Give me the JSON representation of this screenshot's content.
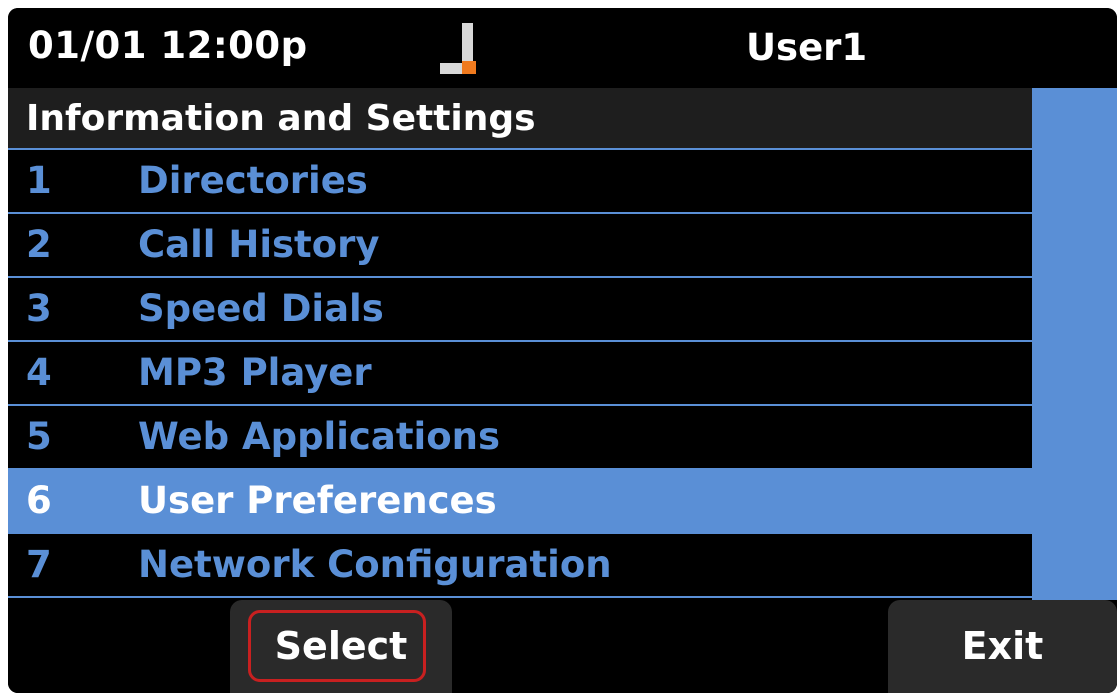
{
  "status": {
    "datetime": "01/01 12:00p",
    "user": "User1",
    "line_icon": "line-status-icon"
  },
  "menu": {
    "title": "Information and Settings",
    "items": [
      {
        "number": "1",
        "label": "Directories"
      },
      {
        "number": "2",
        "label": "Call History"
      },
      {
        "number": "3",
        "label": "Speed Dials"
      },
      {
        "number": "4",
        "label": "MP3 Player"
      },
      {
        "number": "5",
        "label": "Web Applications"
      },
      {
        "number": "6",
        "label": "User Preferences",
        "selected": true
      },
      {
        "number": "7",
        "label": "Network Configuration"
      }
    ]
  },
  "softkeys": {
    "select_label": "Select",
    "exit_label": "Exit"
  },
  "colors": {
    "accent": "#5a8fd6",
    "background": "#000000",
    "header_bg": "#1e1e1e",
    "softkey_bg": "#2a2a2a",
    "highlight_border": "#c82020"
  }
}
